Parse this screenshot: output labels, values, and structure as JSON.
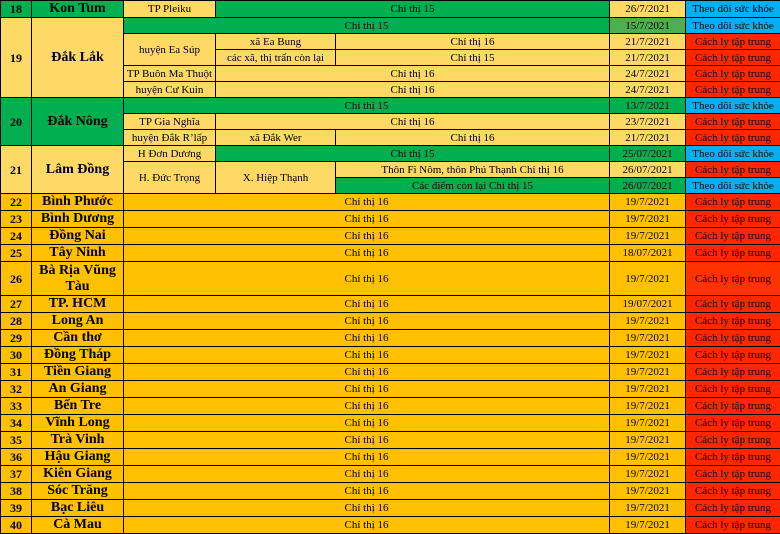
{
  "rows": [
    {
      "no": "18",
      "province": "Kon Tum"
    },
    {
      "no": "19",
      "province": "Đắk Lắk"
    },
    {
      "no": "20",
      "province": "Đắk Nông"
    },
    {
      "no": "21",
      "province": "Lâm Đồng"
    },
    {
      "no": "22",
      "province": "Bình Phước"
    },
    {
      "no": "23",
      "province": "Bình Dương"
    },
    {
      "no": "24",
      "province": "Đồng Nai"
    },
    {
      "no": "25",
      "province": "Tây Ninh"
    },
    {
      "no": "26",
      "province": "Bà Rịa Vũng Tàu"
    },
    {
      "no": "27",
      "province": "TP. HCM"
    },
    {
      "no": "28",
      "province": "Long An"
    },
    {
      "no": "29",
      "province": "Cần thơ"
    },
    {
      "no": "30",
      "province": "Đồng Tháp"
    },
    {
      "no": "31",
      "province": "Tiền Giang"
    },
    {
      "no": "32",
      "province": "An Giang"
    },
    {
      "no": "33",
      "province": "Bến Tre"
    },
    {
      "no": "34",
      "province": "Vĩnh Long"
    },
    {
      "no": "35",
      "province": "Trà Vinh"
    },
    {
      "no": "36",
      "province": "Hậu Giang"
    },
    {
      "no": "37",
      "province": "Kiên Giang"
    },
    {
      "no": "38",
      "province": "Sóc Trăng"
    },
    {
      "no": "39",
      "province": "Bạc Liêu"
    },
    {
      "no": "40",
      "province": "Cà Mau"
    }
  ],
  "sub": {
    "kt_area": "TP Pleiku",
    "kt_dir": "Chỉ thị 15",
    "kt_date": "26/7/2021",
    "kt_action": "Theo dõi sức khỏe",
    "dl1_dir": "Chỉ thị 15",
    "dl1_date": "15/7/2021",
    "dl1_action": "Theo dõi sức khỏe",
    "dl_ea_sup": "huyện Ea Súp",
    "dl_ea_bung": "xã Ea Bung",
    "dl_ea_bung_dir": "Chỉ thị 16",
    "dl_ea_bung_date": "21/7/2021",
    "dl_ea_bung_action": "Cách ly tập trung",
    "dl_rest": "các xã, thị trấn còn lại",
    "dl_rest_dir": "Chỉ thị 15",
    "dl_rest_date": "21/7/2021",
    "dl_rest_action": "Cách ly tập trung",
    "dl_bmt": "TP Buôn Ma Thuột",
    "dl_bmt_dir": "Chỉ thị 16",
    "dl_bmt_date": "24/7/2021",
    "dl_bmt_action": "Cách ly tập trung",
    "dl_ck": "huyện Cư Kuin",
    "dl_ck_dir": "Chỉ thị 16",
    "dl_ck_date": "24/7/2021",
    "dl_ck_action": "Cách ly tập trung",
    "dn1_dir": "Chỉ thị 15",
    "dn1_date": "13/7/2021",
    "dn1_action": "Theo dõi sức khỏe",
    "dn_gn": "TP Gia Nghĩa",
    "dn_gn_dir": "Chỉ thị 16",
    "dn_gn_date": "23/7/2021",
    "dn_gn_action": "Cách ly tập trung",
    "dn_dr": "huyện Đắk R’lấp",
    "dn_wer": "xã Đắk Wer",
    "dn_wer_dir": "Chỉ thị 16",
    "dn_wer_date": "21/7/2021",
    "dn_wer_action": "Cách ly tập trung",
    "ld_dd": "H Đơn Dương",
    "ld_dd_dir": "Chỉ thị 15",
    "ld_dd_date": "25/07/2021",
    "ld_dd_action": "Theo dõi sức khỏe",
    "ld_dt": "H. Đức Trọng",
    "ld_ht": "X. Hiệp Thạnh",
    "ld_fn": "Thôn Fi Nôm, thôn Phú Thạnh Chỉ thị 16",
    "ld_fn_date": "26/07/2021",
    "ld_fn_action": "Cách ly tập trung",
    "ld_rest": "Các điểm còn lại    Chỉ thị 15",
    "ld_rest_date": "26/07/2021",
    "ld_rest_action": "Theo dõi sức khỏe"
  },
  "simple": [
    {
      "dir": "Chỉ thị 16",
      "date": "19/7/2021",
      "action": "Cách ly tập trung"
    },
    {
      "dir": "Chỉ thị 16",
      "date": "19/7/2021",
      "action": "Cách ly tập trung"
    },
    {
      "dir": "Chỉ thị 16",
      "date": "19/7/2021",
      "action": "Cách ly tập trung"
    },
    {
      "dir": "Chỉ thị 16",
      "date": "18/07/2021",
      "action": "Cách ly tập trung"
    },
    {
      "dir": "Chỉ thị 16",
      "date": "19/7/2021",
      "action": "Cách ly tập trung"
    },
    {
      "dir": "Chỉ thị 16",
      "date": "19/07/2021",
      "action": "Cách ly tập trung"
    },
    {
      "dir": "Chỉ thị 16",
      "date": "19/7/2021",
      "action": "Cách ly tập trung"
    },
    {
      "dir": "Chỉ thị 16",
      "date": "19/7/2021",
      "action": "Cách ly tập trung"
    },
    {
      "dir": "Chỉ thị 16",
      "date": "19/7/2021",
      "action": "Cách ly tập trung"
    },
    {
      "dir": "Chỉ thị 16",
      "date": "19/7/2021",
      "action": "Cách ly tập trung"
    },
    {
      "dir": "Chỉ thị 16",
      "date": "19/7/2021",
      "action": "Cách ly tập trung"
    },
    {
      "dir": "Chỉ thị 16",
      "date": "19/7/2021",
      "action": "Cách ly tập trung"
    },
    {
      "dir": "Chỉ thị 16",
      "date": "19/7/2021",
      "action": "Cách ly tập trung"
    },
    {
      "dir": "Chỉ thị 16",
      "date": "19/7/2021",
      "action": "Cách ly tập trung"
    },
    {
      "dir": "Chỉ thị 16",
      "date": "19/7/2021",
      "action": "Cách ly tập trung"
    },
    {
      "dir": "Chỉ thị 16",
      "date": "19/7/2021",
      "action": "Cách ly tập trung"
    },
    {
      "dir": "Chỉ thị 16",
      "date": "19/7/2021",
      "action": "Cách ly tập trung"
    },
    {
      "dir": "Chỉ thị 16",
      "date": "19/7/2021",
      "action": "Cách ly tập trung"
    },
    {
      "dir": "Chỉ thị 16",
      "date": "19/7/2021",
      "action": "Cách ly tập trung"
    }
  ],
  "colors": {
    "yellow": "#ffd966",
    "orange": "#ffc000",
    "green": "#00b050",
    "red": "#ff2600",
    "blue": "#00b0f0"
  }
}
